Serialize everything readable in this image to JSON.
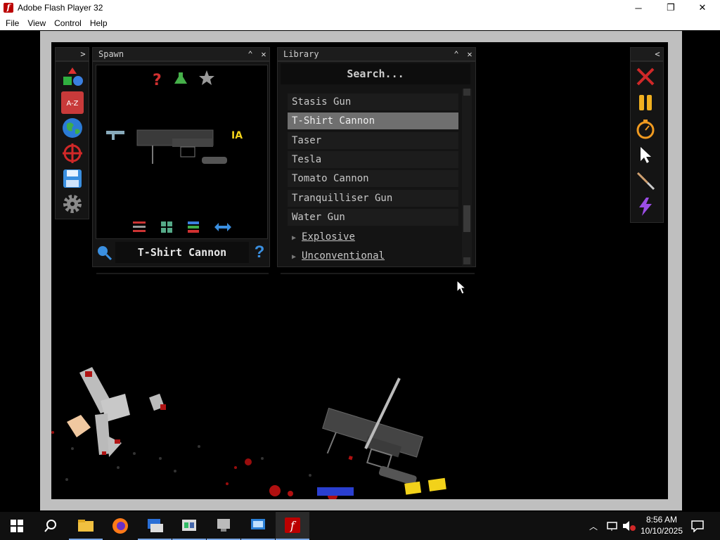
{
  "window": {
    "title": "Adobe Flash Player 32",
    "minimize": "─",
    "restore": "❐",
    "close": "✕"
  },
  "menu": [
    "File",
    "View",
    "Control",
    "Help"
  ],
  "spawn_panel": {
    "title": "Spawn",
    "expand_glyph": ">",
    "item_name": "T-Shirt Cannon",
    "help_glyph": "?",
    "icons_top": [
      "question-icon",
      "flask-icon",
      "star-icon"
    ],
    "icons_bottom": [
      "sliders-icon",
      "grid-icon",
      "layers-icon",
      "swap-icon"
    ]
  },
  "left_tools": [
    "shapes-icon",
    "a-z-icon",
    "globe-icon",
    "crosshair-icon",
    "save-icon",
    "gear-icon"
  ],
  "library": {
    "title": "Library",
    "search_placeholder": "Search...",
    "items": [
      "Stasis Gun",
      "T-Shirt Cannon",
      "Taser",
      "Tesla",
      "Tomato Cannon",
      "Tranquilliser Gun",
      "Water Gun"
    ],
    "selected": "T-Shirt Cannon",
    "categories": [
      "Explosive",
      "Unconventional"
    ]
  },
  "right_tools": [
    "close-x-icon",
    "pause-icon",
    "stopwatch-icon",
    "cursor-icon",
    "knife-icon",
    "lightning-icon"
  ],
  "right_panel": {
    "collapse_glyph": "<"
  },
  "taskbar": {
    "time": "8:56 AM",
    "date": "10/10/2025",
    "apps": [
      "start-icon",
      "search-icon",
      "file-explorer-icon",
      "firefox-icon",
      "app-icon-1",
      "app-icon-2",
      "app-icon-3",
      "app-icon-4",
      "flash-player-icon"
    ]
  },
  "colors": {
    "accent_blue": "#3a8fe0",
    "selected_row": "#6f6f6f",
    "panel_bg": "#141414"
  }
}
